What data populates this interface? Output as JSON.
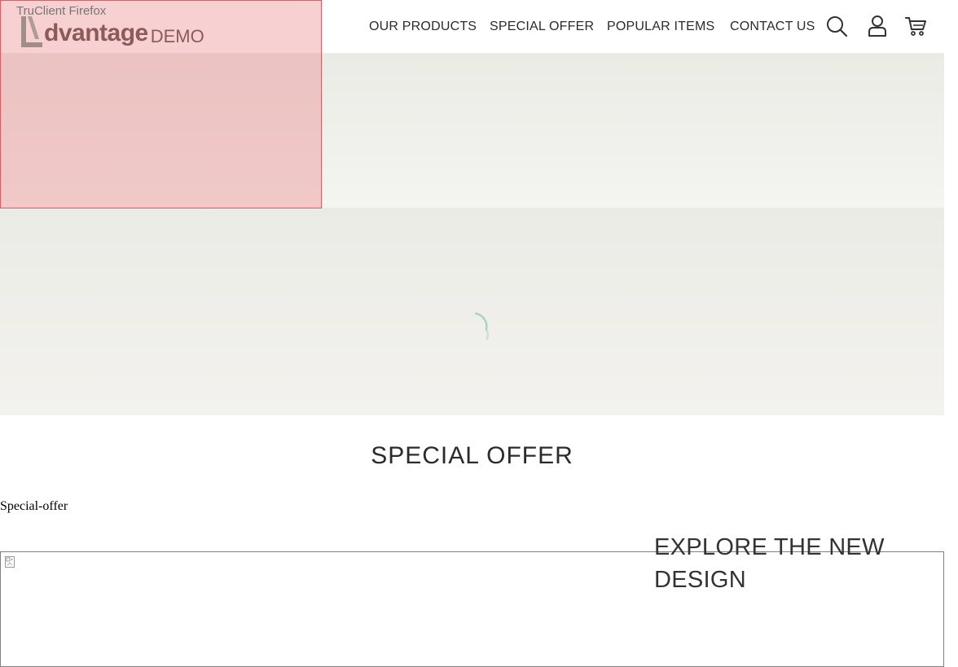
{
  "overlay": {
    "label": "TruClient Firefox"
  },
  "header": {
    "logo": {
      "word": "dvantage",
      "demo": "DEMO"
    },
    "nav": {
      "our_products": "OUR PRODUCTS",
      "special_offer": "SPECIAL OFFER",
      "popular_items": "POPULAR ITEMS",
      "contact_us": "CONTACT US"
    },
    "icons": [
      "search-icon",
      "user-icon",
      "cart-icon"
    ]
  },
  "main": {
    "section_title": "SPECIAL OFFER",
    "special_offer_text": "Special-offer",
    "explore_title": "EXPLORE THE NEW DESIGN"
  },
  "colors": {
    "logo_text": "#5a4a45",
    "logo_accent": "#7a9a8e",
    "banner_bg": "#ebebe6",
    "overlay": "#e85a5f",
    "spinner": "#5fb8b0"
  }
}
